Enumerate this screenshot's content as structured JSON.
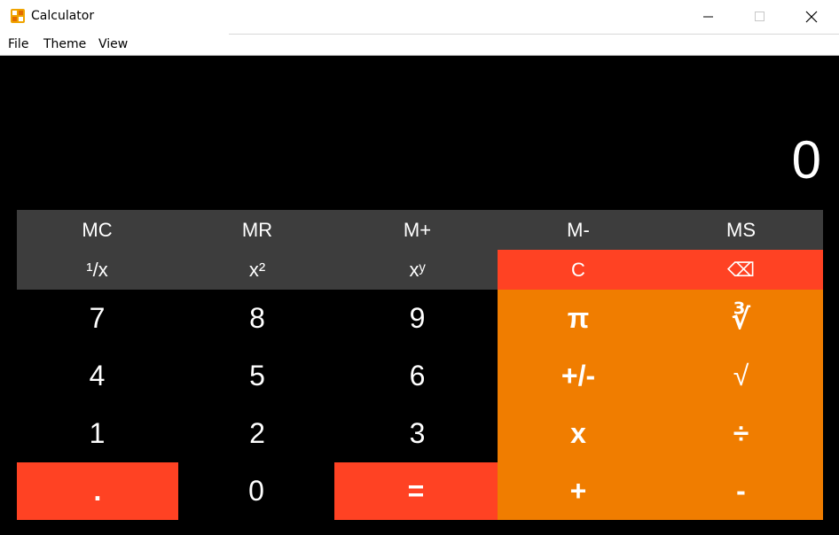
{
  "window": {
    "title": "Calculator",
    "minimize_icon": "minimize-icon",
    "maximize_icon": "maximize-icon",
    "close_icon": "close-icon"
  },
  "menu": {
    "file": "File",
    "theme": "Theme",
    "view": "View"
  },
  "display": {
    "value": "0"
  },
  "memory": {
    "mc": "MC",
    "mr": "MR",
    "mplus": "M+",
    "mminus": "M-",
    "ms": "MS"
  },
  "functions": {
    "reciprocal": "¹/x",
    "square": "x²",
    "power": "xʸ",
    "clear": "C",
    "backspace": "⌫"
  },
  "digits": {
    "seven": "7",
    "eight": "8",
    "nine": "9",
    "four": "4",
    "five": "5",
    "six": "6",
    "one": "1",
    "two": "2",
    "three": "3",
    "zero": "0",
    "decimal": "."
  },
  "operators": {
    "pi": "π",
    "cube_root": "∛",
    "negate": "+/-",
    "sqrt": "√",
    "multiply": "x",
    "divide": "÷",
    "add": "+",
    "subtract": "-",
    "equals": "="
  },
  "colors": {
    "memory_bg": "#3d3d3d",
    "accent_red": "#ff4223",
    "accent_orange": "#f07d00"
  }
}
